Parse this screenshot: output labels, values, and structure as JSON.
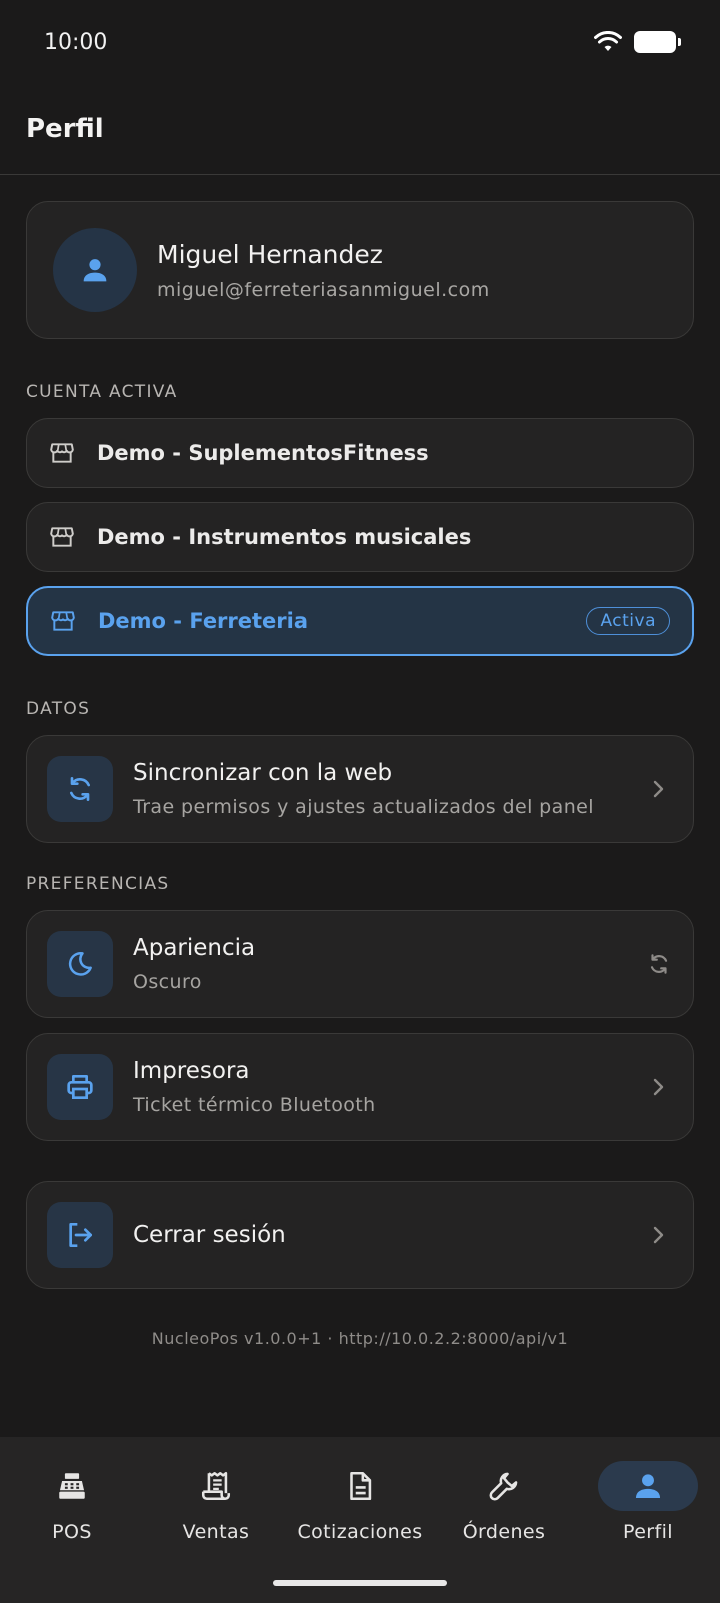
{
  "status_bar": {
    "time": "10:00"
  },
  "app_bar": {
    "title": "Perfil"
  },
  "profile": {
    "name": "Miguel Hernandez",
    "email": "miguel@ferreteriasanmiguel.com"
  },
  "sections": {
    "accounts": "CUENTA ACTIVA",
    "data": "DATOS",
    "preferences": "PREFERENCIAS"
  },
  "accounts": [
    {
      "label": "Demo - SuplementosFitness",
      "active": false
    },
    {
      "label": "Demo - Instrumentos musicales",
      "active": false
    },
    {
      "label": "Demo - Ferreteria",
      "active": true,
      "badge": "Activa"
    }
  ],
  "sync": {
    "title": "Sincronizar con la web",
    "subtitle": "Trae permisos y ajustes actualizados del panel"
  },
  "appearance": {
    "title": "Apariencia",
    "subtitle": "Oscuro"
  },
  "printer": {
    "title": "Impresora",
    "subtitle": "Ticket térmico Bluetooth"
  },
  "logout": {
    "title": "Cerrar sesión"
  },
  "footer": {
    "text": "NucleoPos v1.0.0+1  ·  http://10.0.2.2:8000/api/v1"
  },
  "nav": [
    {
      "label": "POS",
      "icon": "cash-register-icon"
    },
    {
      "label": "Ventas",
      "icon": "receipt-icon"
    },
    {
      "label": "Cotizaciones",
      "icon": "document-icon"
    },
    {
      "label": "Órdenes",
      "icon": "wrench-icon"
    },
    {
      "label": "Perfil",
      "icon": "person-icon",
      "selected": true
    }
  ],
  "colors": {
    "background": "#1b1a1a",
    "card": "#242323",
    "accent": "#5aa2ee",
    "active_bg": "#243445"
  }
}
